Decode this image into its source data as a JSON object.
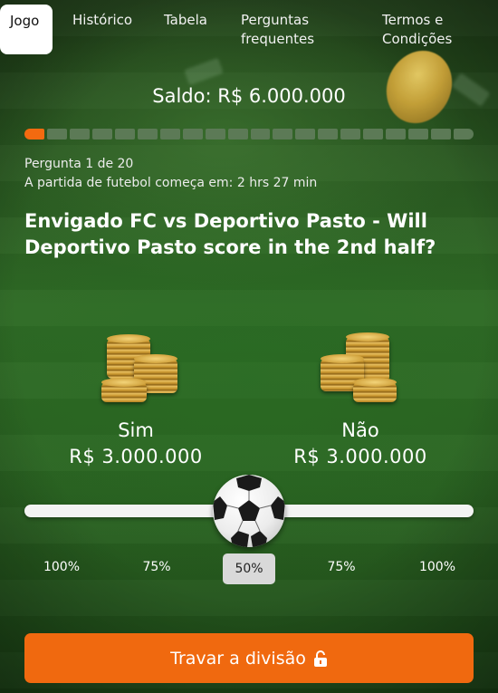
{
  "nav": {
    "tabs": [
      {
        "label": "Jogo",
        "active": true
      },
      {
        "label": "Histórico"
      },
      {
        "label": "Tabela"
      },
      {
        "label": "Perguntas\nfrequentes"
      },
      {
        "label": "Termos e\nCondições"
      }
    ]
  },
  "balance": {
    "label": "Saldo:",
    "amount": "R$ 6.000.000"
  },
  "progress": {
    "current": 1,
    "total": 20
  },
  "info": {
    "question_counter": "Pergunta 1 de 20",
    "match_start": "A partida de futebol começa em: 2 hrs 27 min"
  },
  "question": "Envigado FC vs Deportivo Pasto - Will Deportivo Pasto score in the 2nd half?",
  "options": {
    "yes": {
      "label": "Sim",
      "amount": "R$ 3.000.000"
    },
    "no": {
      "label": "Não",
      "amount": "R$ 3.000.000"
    }
  },
  "slider": {
    "value_percent": 50,
    "stops": [
      "100%",
      "75%",
      "50%",
      "75%",
      "100%"
    ],
    "selected_index": 2
  },
  "button": {
    "label": "Travar a divisão",
    "icon": "lock-icon"
  },
  "colors": {
    "accent": "#f0690f",
    "progress_done": "#f36a10",
    "progress_todo": "#5c7a56"
  }
}
